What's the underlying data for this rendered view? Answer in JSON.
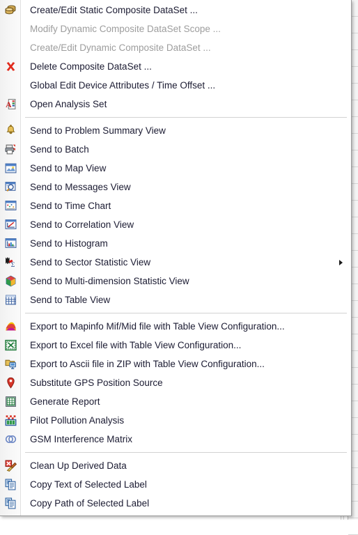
{
  "menu": {
    "name": "dataset-context-menu",
    "groups": [
      {
        "id": "dataset-group",
        "items": [
          {
            "label": "Create/Edit Static Composite DataSet ...",
            "icon": "database-stack-icon",
            "enabled": true,
            "submenu": false
          },
          {
            "label": "Modify Dynamic Composite DataSet Scope ...",
            "icon": "none",
            "enabled": false,
            "submenu": false
          },
          {
            "label": "Create/Edit Dynamic Composite DataSet ...",
            "icon": "none",
            "enabled": false,
            "submenu": false
          },
          {
            "label": "Delete Composite DataSet ...",
            "icon": "red-x-icon",
            "enabled": true,
            "submenu": false
          },
          {
            "label": "Global Edit Device Attributes / Time Offset ...",
            "icon": "none",
            "enabled": true,
            "submenu": false
          },
          {
            "label": "Open Analysis Set",
            "icon": "analysis-set-icon",
            "enabled": true,
            "submenu": false
          }
        ]
      },
      {
        "id": "send-to-group",
        "items": [
          {
            "label": "Send to Problem Summary View",
            "icon": "bell-icon",
            "enabled": true,
            "submenu": false
          },
          {
            "label": "Send to Batch",
            "icon": "printer-batch-icon",
            "enabled": true,
            "submenu": false
          },
          {
            "label": "Send to Map View",
            "icon": "map-view-icon",
            "enabled": true,
            "submenu": false
          },
          {
            "label": "Send to Messages View",
            "icon": "messages-view-icon",
            "enabled": true,
            "submenu": false
          },
          {
            "label": "Send to Time Chart",
            "icon": "time-chart-icon",
            "enabled": true,
            "submenu": false
          },
          {
            "label": "Send to Correlation View",
            "icon": "correlation-view-icon",
            "enabled": true,
            "submenu": false
          },
          {
            "label": "Send to Histogram",
            "icon": "histogram-icon",
            "enabled": true,
            "submenu": false
          },
          {
            "label": "Send to Sector Statistic View",
            "icon": "sector-statistic-icon",
            "enabled": true,
            "submenu": true
          },
          {
            "label": "Send to Multi-dimension Statistic View",
            "icon": "cube-icon",
            "enabled": true,
            "submenu": false
          },
          {
            "label": "Send to Table View",
            "icon": "table-view-icon",
            "enabled": true,
            "submenu": false
          }
        ]
      },
      {
        "id": "export-group",
        "items": [
          {
            "label": "Export to Mapinfo Mif/Mid file with Table View Configuration...",
            "icon": "mapinfo-icon",
            "enabled": true,
            "submenu": false
          },
          {
            "label": "Export to Excel file with Table View Configuration...",
            "icon": "excel-icon",
            "enabled": true,
            "submenu": false
          },
          {
            "label": "Export to Ascii file in ZIP with Table View Configuration...",
            "icon": "ascii-zip-icon",
            "enabled": true,
            "submenu": false
          },
          {
            "label": "Substitute GPS Position Source",
            "icon": "gps-pin-icon",
            "enabled": true,
            "submenu": false
          },
          {
            "label": "Generate Report",
            "icon": "report-icon",
            "enabled": true,
            "submenu": false
          },
          {
            "label": "Pilot Pollution Analysis",
            "icon": "pilot-pollution-icon",
            "enabled": true,
            "submenu": false
          },
          {
            "label": "GSM Interference Matrix",
            "icon": "interference-matrix-icon",
            "enabled": true,
            "submenu": false
          }
        ]
      },
      {
        "id": "clipboard-group",
        "items": [
          {
            "label": "Clean Up Derived Data",
            "icon": "clean-up-icon",
            "enabled": true,
            "submenu": false
          },
          {
            "label": "Copy Text of Selected Label",
            "icon": "copy-icon",
            "enabled": true,
            "submenu": false
          },
          {
            "label": "Copy Path of Selected Label",
            "icon": "copy-icon",
            "enabled": true,
            "submenu": false
          }
        ]
      }
    ]
  },
  "colors": {
    "menu_background": "#ffffff",
    "gutter_background": "#f5f5f5",
    "text": "#1b1b32",
    "disabled_text": "#9d9d9d",
    "separator": "#d2d2d2",
    "border": "#9a9a9a",
    "accent_red": "#d42a25",
    "accent_blue": "#2f6fb5",
    "accent_green": "#1e8a3c"
  }
}
